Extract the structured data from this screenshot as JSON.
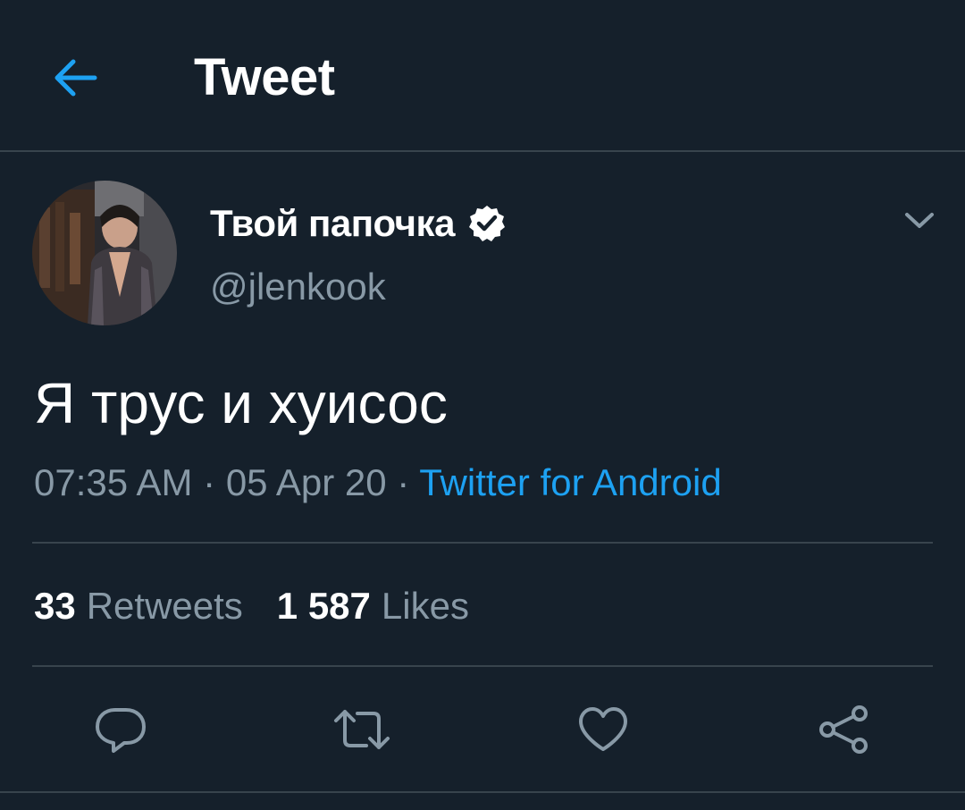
{
  "header": {
    "title": "Tweet",
    "back_icon": "arrow-left-icon"
  },
  "author": {
    "display_name": "Твой папочка",
    "handle": "@jlenkook",
    "verified_icon": "verified-badge-icon",
    "more_icon": "chevron-down-icon"
  },
  "tweet": {
    "text": "Я трус и хуисос",
    "time": "07:35 AM",
    "separator": "·",
    "date": "05 Apr 20",
    "source": "Twitter for Android"
  },
  "stats": {
    "retweets_count": "33",
    "retweets_label": "Retweets",
    "likes_count": "1 587",
    "likes_label": "Likes"
  },
  "actions": {
    "reply_icon": "reply-icon",
    "retweet_icon": "retweet-icon",
    "like_icon": "heart-icon",
    "share_icon": "share-icon"
  },
  "colors": {
    "background": "#15202B",
    "accent": "#1DA1F2",
    "secondary_text": "#8899A6",
    "divider": "#38444D"
  }
}
